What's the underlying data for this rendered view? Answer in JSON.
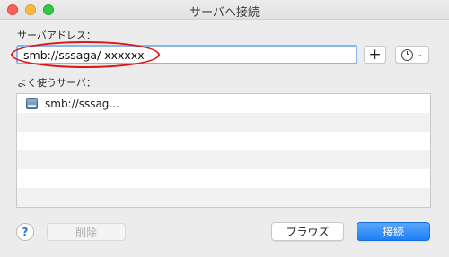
{
  "window": {
    "title": "サーバへ接続"
  },
  "address": {
    "label": "サーバアドレス：",
    "value": "smb://sssaga/ xxxxxx"
  },
  "toolbar": {
    "add_label": "+",
    "recent_chevron": "⌄"
  },
  "favorites": {
    "label": "よく使うサーバ：",
    "items": [
      {
        "name": "smb://sssag..."
      }
    ]
  },
  "footer": {
    "help_label": "?",
    "delete_label": "削除",
    "browse_label": "ブラウズ",
    "connect_label": "接続"
  },
  "colors": {
    "accent": "#1c7ff4",
    "annotation": "#e0141b"
  },
  "icons": [
    "close-icon",
    "minimize-icon",
    "maximize-icon",
    "clock-icon",
    "chevron-down-icon",
    "server-icon",
    "help-icon"
  ]
}
